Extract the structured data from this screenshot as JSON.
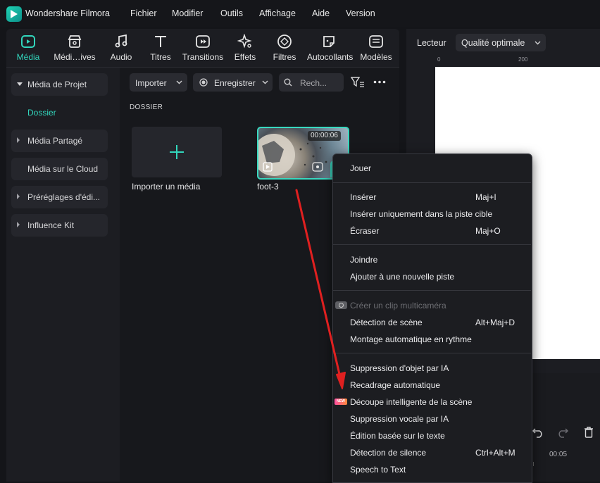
{
  "app": {
    "name": "Wondershare Filmora"
  },
  "menubar": [
    "Fichier",
    "Modifier",
    "Outils",
    "Affichage",
    "Aide",
    "Version"
  ],
  "toolbar_tabs": [
    {
      "label": "Média",
      "icon": "media-icon",
      "active": true
    },
    {
      "label": "Médi…ives",
      "icon": "store-icon",
      "active": false
    },
    {
      "label": "Audio",
      "icon": "music-note-icon",
      "active": false
    },
    {
      "label": "Titres",
      "icon": "text-t-icon",
      "active": false
    },
    {
      "label": "Transitions",
      "icon": "transition-icon",
      "active": false
    },
    {
      "label": "Effets",
      "icon": "effects-sparkle-icon",
      "active": false
    },
    {
      "label": "Filtres",
      "icon": "filter-icon",
      "active": false
    },
    {
      "label": "Autocollants",
      "icon": "sticker-icon",
      "active": false
    },
    {
      "label": "Modèles",
      "icon": "template-icon",
      "active": false
    }
  ],
  "sidebar": {
    "items": [
      {
        "label": "Média de Projet",
        "expanded": true
      },
      {
        "label": "Dossier",
        "selected": true
      },
      {
        "label": "Média Partagé",
        "expanded": false
      },
      {
        "label": "Média sur le Cloud"
      },
      {
        "label": "Préréglages d'édi...",
        "expanded": false
      },
      {
        "label": "Influence Kit",
        "expanded": false
      }
    ]
  },
  "media": {
    "import_button": "Importer",
    "record_button": "Enregistrer",
    "search_placeholder": "Rech...",
    "section_title": "DOSSIER",
    "import_card_label": "Importer un média",
    "clip": {
      "name": "foot-3",
      "duration": "00:00:06"
    }
  },
  "player": {
    "label": "Lecteur",
    "quality": "Qualité optimale",
    "ruler_ticks": [
      "0",
      "200"
    ],
    "timeline_time": "00:05"
  },
  "context_menu": {
    "groups": [
      [
        {
          "label": "Jouer",
          "shortcut": ""
        }
      ],
      [
        {
          "label": "Insérer",
          "shortcut": "Maj+I"
        },
        {
          "label": "Insérer uniquement dans la piste cible",
          "shortcut": ""
        },
        {
          "label": "Écraser",
          "shortcut": "Maj+O"
        }
      ],
      [
        {
          "label": "Joindre",
          "shortcut": ""
        },
        {
          "label": "Ajouter à une nouvelle piste",
          "shortcut": ""
        }
      ],
      [
        {
          "label": "Créer un clip multicaméra",
          "shortcut": "",
          "disabled": true
        },
        {
          "label": "Détection de scène",
          "shortcut": "Alt+Maj+D"
        },
        {
          "label": "Montage automatique en rythme",
          "shortcut": ""
        }
      ],
      [
        {
          "label": "Suppression d'objet par IA",
          "shortcut": ""
        },
        {
          "label": "Recadrage automatique",
          "shortcut": ""
        },
        {
          "label": "Découpe intelligente de la scène",
          "shortcut": "",
          "badge": "NEW"
        },
        {
          "label": "Suppression vocale par IA",
          "shortcut": ""
        },
        {
          "label": "Édition basée sur le texte",
          "shortcut": ""
        },
        {
          "label": "Détection de silence",
          "shortcut": "Ctrl+Alt+M"
        },
        {
          "label": "Speech to Text",
          "shortcut": ""
        }
      ]
    ]
  },
  "colors": {
    "accent": "#32d7bd",
    "annotation_arrow": "#e02020",
    "background": "#141519"
  }
}
